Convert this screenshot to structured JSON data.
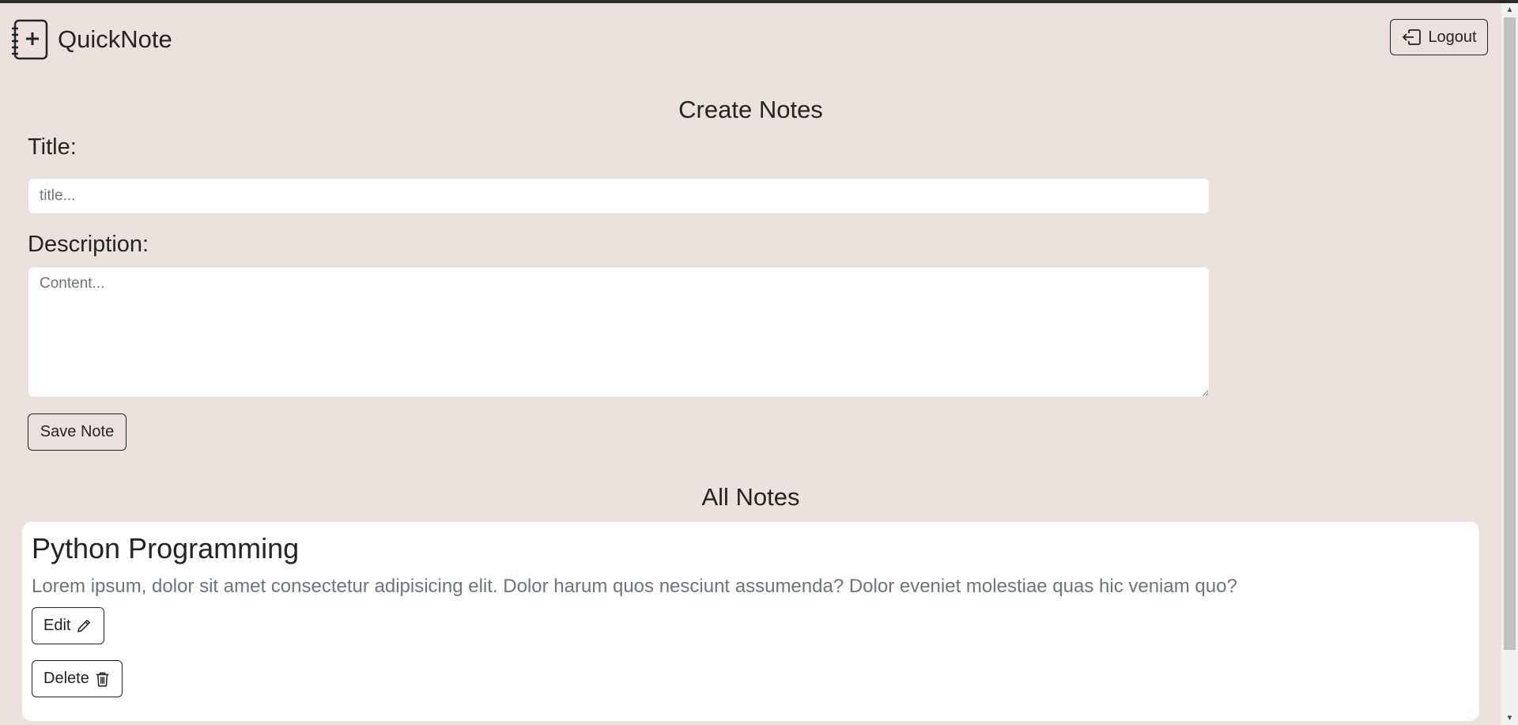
{
  "navbar": {
    "brand": "QuickNote",
    "brand_icon": "notebook-plus-icon",
    "logout_label": "Logout",
    "logout_icon": "logout-icon"
  },
  "create": {
    "heading": "Create Notes",
    "title_label": "Title:",
    "title_placeholder": "title...",
    "title_value": "",
    "description_label": "Description:",
    "description_placeholder": "Content...",
    "description_value": "",
    "save_label": "Save Note"
  },
  "notes": {
    "heading": "All Notes",
    "items": [
      {
        "title": "Python Programming",
        "description": "Lorem ipsum, dolor sit amet consectetur adipisicing elit. Dolor harum quos nesciunt assumenda? Dolor eveniet molestiae quas hic veniam quo?",
        "edit_label": "Edit",
        "edit_icon": "pencil-icon",
        "delete_label": "Delete",
        "delete_icon": "trash-icon"
      }
    ]
  },
  "colors": {
    "background": "#ece1dc",
    "card": "#ffffff",
    "text": "#212529",
    "muted": "#6c757d"
  }
}
